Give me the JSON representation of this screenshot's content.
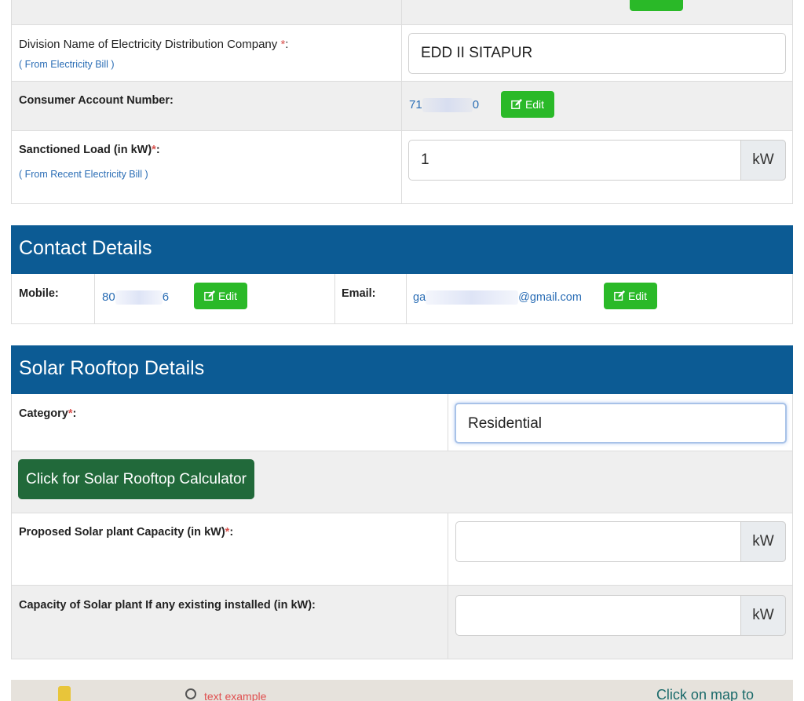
{
  "electricity": {
    "division_label": "Division Name of Electricity Distribution Company ",
    "division_required": "*",
    "division_colon": ":",
    "division_hint": "( From Electricity Bill )",
    "division_value": "EDD II SITAPUR",
    "consumer_label": "Consumer Account Number:",
    "consumer_prefix": "71",
    "consumer_suffix": "0",
    "edit_label": "Edit",
    "sanctioned_label": "Sanctioned Load (in kW)",
    "sanctioned_required": "*",
    "sanctioned_colon": ":",
    "sanctioned_hint": "( From Recent Electricity Bill )",
    "sanctioned_value": "1",
    "unit": "kW"
  },
  "contact": {
    "title": "Contact Details",
    "mobile_label": "Mobile:",
    "mobile_prefix": "80",
    "mobile_suffix": "6",
    "email_label": "Email:",
    "email_prefix": "ga",
    "email_suffix": "@gmail.com",
    "edit_label": "Edit"
  },
  "solar": {
    "title": "Solar Rooftop Details",
    "category_label": "Category",
    "category_required": "*",
    "category_colon": ":",
    "category_value": "Residential",
    "calculator_button": "Click for Solar Rooftop Calculator",
    "proposed_label": "Proposed Solar plant Capacity (in kW)",
    "proposed_required": "*",
    "proposed_colon": ":",
    "proposed_value": "",
    "existing_label": "Capacity of Solar plant If any existing installed (in kW):",
    "existing_value": "",
    "unit": "kW"
  },
  "map": {
    "text_example": "text example",
    "click_hint": "Click on map to"
  },
  "colors": {
    "section_header": "#0c5b94",
    "edit_button": "#2ab928",
    "calculator_button": "#21693a",
    "link": "#2a6db5",
    "required": "#d9534f"
  }
}
